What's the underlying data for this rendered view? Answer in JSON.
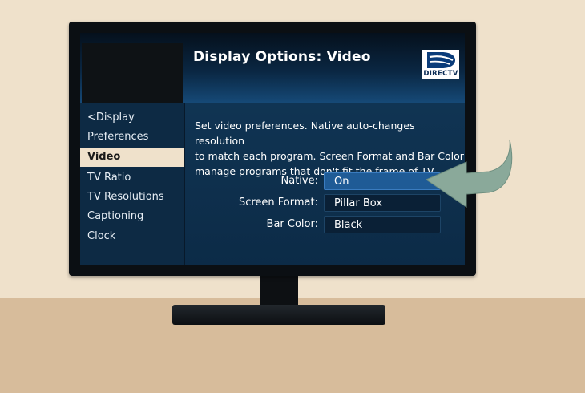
{
  "colors": {
    "wall": "#efe1cb",
    "table": "#d7bc9b",
    "screen": "#0c2a44",
    "selected_highlight": "#1f5b96",
    "nav_active_bg": "#efe1cb",
    "arrow": "#8aa99a"
  },
  "header": {
    "title": "Display Options: Video",
    "logo_text": "DIRECTV"
  },
  "sidebar": {
    "items": [
      {
        "label": "<Display"
      },
      {
        "label": "Preferences"
      },
      {
        "label": "Video",
        "active": true
      },
      {
        "label": "TV Ratio"
      },
      {
        "label": "TV Resolutions"
      },
      {
        "label": "Captioning"
      },
      {
        "label": "Clock"
      }
    ]
  },
  "main": {
    "description": "Set video preferences. Native auto-changes resolution\nto match each program. Screen Format and Bar Color\nmanage programs that don't fit the frame of TV.",
    "options": [
      {
        "label": "Native:",
        "value": "On",
        "selected": true
      },
      {
        "label": "Screen Format:",
        "value": "Pillar Box"
      },
      {
        "label": "Bar Color:",
        "value": "Black"
      }
    ]
  },
  "icons": {
    "logo": "directv-logo-icon",
    "pointer": "curved-arrow-icon"
  }
}
